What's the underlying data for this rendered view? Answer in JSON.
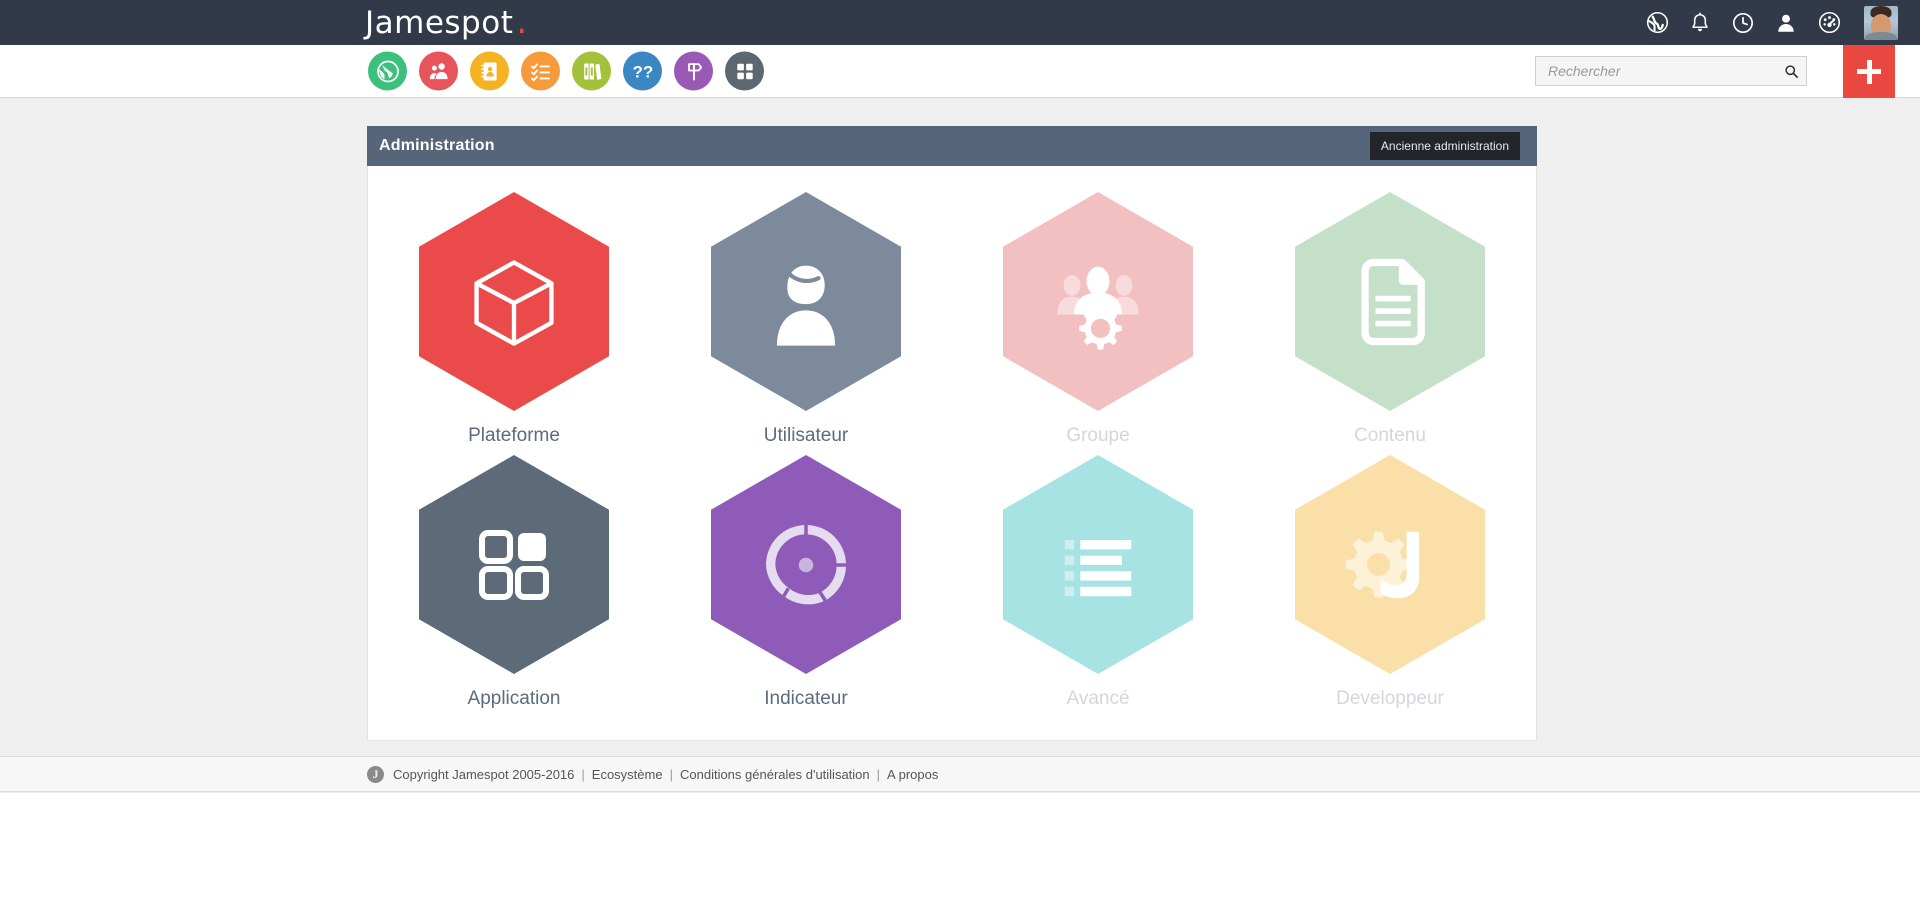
{
  "topbar": {
    "logo_text": "Jamespot",
    "logo_dot": ".",
    "icons": [
      {
        "name": "globe-icon",
        "label": "Réseaux"
      },
      {
        "name": "bell-icon",
        "label": "Notifications"
      },
      {
        "name": "clock-icon",
        "label": "Activité récente"
      },
      {
        "name": "user-icon",
        "label": "Mon profil"
      },
      {
        "name": "dashboard-icon",
        "label": "Tableau de bord"
      }
    ],
    "avatar_alt": "Photo de profil"
  },
  "nav": {
    "items": [
      {
        "name": "nav-globe",
        "label": "Réseau",
        "color": "#3dc07c"
      },
      {
        "name": "nav-people",
        "label": "Communautés",
        "color": "#e8545c"
      },
      {
        "name": "nav-directory",
        "label": "Annuaire",
        "color": "#f5b324"
      },
      {
        "name": "nav-tasks",
        "label": "Tâches",
        "color": "#f79a3b"
      },
      {
        "name": "nav-library",
        "label": "Documents",
        "color": "#a5c13c"
      },
      {
        "name": "nav-help",
        "label": "Aide",
        "color": "#3b87c4"
      },
      {
        "name": "nav-signpost",
        "label": "Orientation",
        "color": "#9b59b6"
      },
      {
        "name": "nav-apps",
        "label": "Applications",
        "color": "#5d6770"
      }
    ]
  },
  "search": {
    "placeholder": "Rechercher",
    "value": "",
    "icon": "search-icon"
  },
  "add_button": {
    "label": "+",
    "icon": "plus-icon",
    "color": "#e8483f"
  },
  "panel": {
    "title": "Administration",
    "old_admin_label": "Ancienne administration"
  },
  "tiles": [
    {
      "id": "plateforme",
      "label": "Plateforme",
      "color": "#ea4a4a",
      "icon": "cube-icon",
      "disabled": false
    },
    {
      "id": "utilisateur",
      "label": "Utilisateur",
      "color": "#7c8a9c",
      "icon": "user-icon",
      "disabled": false
    },
    {
      "id": "groupe",
      "label": "Groupe",
      "color": "#f3c0c2",
      "icon": "group-gear-icon",
      "disabled": true
    },
    {
      "id": "contenu",
      "label": "Contenu",
      "color": "#c5e0c8",
      "icon": "document-icon",
      "disabled": true
    },
    {
      "id": "application",
      "label": "Application",
      "color": "#5d6a78",
      "icon": "apps-grid-icon",
      "disabled": false
    },
    {
      "id": "indicateur",
      "label": "Indicateur",
      "color": "#8e5cb8",
      "icon": "donut-chart-icon",
      "disabled": false
    },
    {
      "id": "avance",
      "label": "Avancé",
      "color": "#a7e3e3",
      "icon": "list-icon",
      "disabled": true
    },
    {
      "id": "developpeur",
      "label": "Developpeur",
      "color": "#fbdfa8",
      "icon": "gear-j-icon",
      "disabled": true
    }
  ],
  "footer": {
    "logo_letter": "J",
    "copyright": "Copyright Jamespot 2005-2016",
    "separator": "|",
    "links": [
      {
        "label": "Ecosystème"
      },
      {
        "label": "Conditions générales d'utilisation"
      },
      {
        "label": "A propos"
      }
    ]
  }
}
